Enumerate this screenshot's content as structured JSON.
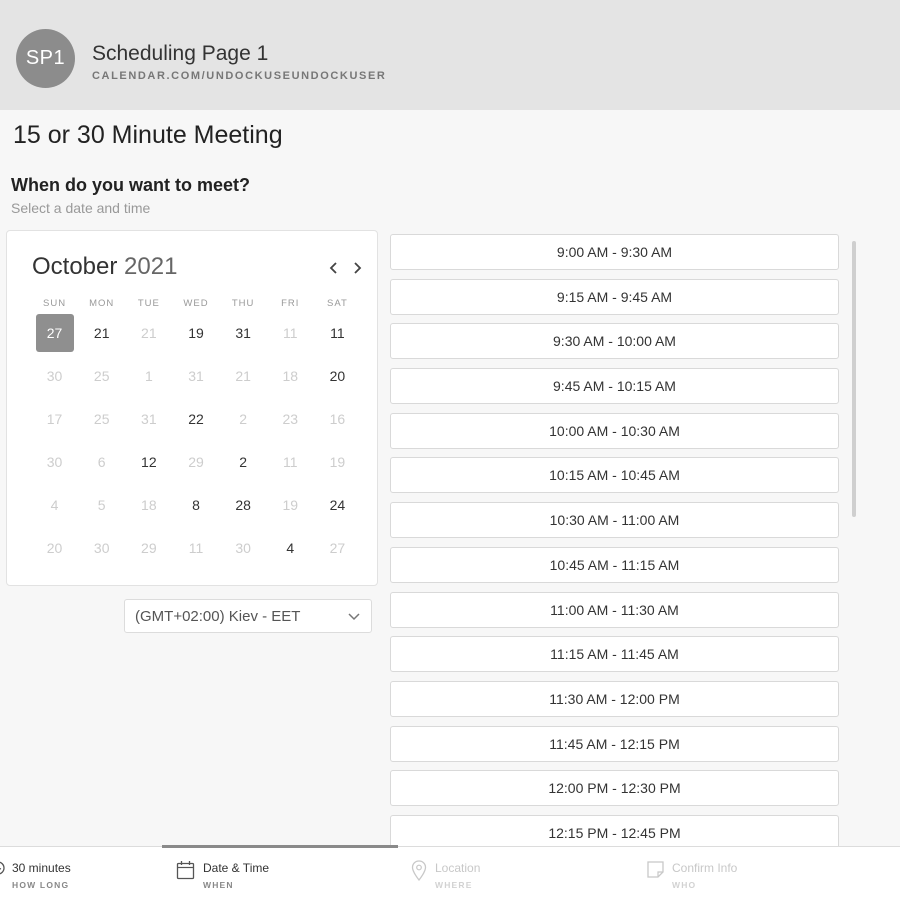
{
  "header": {
    "avatar_initials": "SP1",
    "page_name": "Scheduling Page 1",
    "page_url": "CALENDAR.COM/UNDOCKUSEUNDOCKUSER"
  },
  "meeting": {
    "title": "15 or 30 Minute Meeting",
    "question": "When do you want to meet?",
    "instruction": "Select a date and time"
  },
  "calendar": {
    "month": "October",
    "year": "2021",
    "prev_icon": "chevron-left-icon",
    "next_icon": "chevron-right-icon",
    "weekdays": [
      "SUN",
      "MON",
      "TUE",
      "WED",
      "THU",
      "FRI",
      "SAT"
    ],
    "days": [
      {
        "label": "27",
        "active": true,
        "selected": true
      },
      {
        "label": "21",
        "active": true
      },
      {
        "label": "21",
        "active": false
      },
      {
        "label": "19",
        "active": true
      },
      {
        "label": "31",
        "active": true
      },
      {
        "label": "11",
        "active": false
      },
      {
        "label": "11",
        "active": true
      },
      {
        "label": "30",
        "active": false
      },
      {
        "label": "25",
        "active": false
      },
      {
        "label": "1",
        "active": false
      },
      {
        "label": "31",
        "active": false
      },
      {
        "label": "21",
        "active": false
      },
      {
        "label": "18",
        "active": false
      },
      {
        "label": "20",
        "active": true
      },
      {
        "label": "17",
        "active": false
      },
      {
        "label": "25",
        "active": false
      },
      {
        "label": "31",
        "active": false
      },
      {
        "label": "22",
        "active": true
      },
      {
        "label": "2",
        "active": false
      },
      {
        "label": "23",
        "active": false
      },
      {
        "label": "16",
        "active": false
      },
      {
        "label": "30",
        "active": false
      },
      {
        "label": "6",
        "active": false
      },
      {
        "label": "12",
        "active": true
      },
      {
        "label": "29",
        "active": false
      },
      {
        "label": "2",
        "active": true
      },
      {
        "label": "11",
        "active": false
      },
      {
        "label": "19",
        "active": false
      },
      {
        "label": "4",
        "active": false
      },
      {
        "label": "5",
        "active": false
      },
      {
        "label": "18",
        "active": false
      },
      {
        "label": "8",
        "active": true
      },
      {
        "label": "28",
        "active": true
      },
      {
        "label": "19",
        "active": false
      },
      {
        "label": "24",
        "active": true
      },
      {
        "label": "20",
        "active": false
      },
      {
        "label": "30",
        "active": false
      },
      {
        "label": "29",
        "active": false
      },
      {
        "label": "11",
        "active": false
      },
      {
        "label": "30",
        "active": false
      },
      {
        "label": "4",
        "active": true
      },
      {
        "label": "27",
        "active": false
      }
    ]
  },
  "timezone": {
    "value": "(GMT+02:00) Kiev - EET",
    "icon": "chevron-down-icon"
  },
  "slots": [
    "9:00 AM - 9:30 AM",
    "9:15 AM - 9:45 AM",
    "9:30 AM - 10:00 AM",
    "9:45 AM - 10:15 AM",
    "10:00 AM - 10:30 AM",
    "10:15 AM - 10:45 AM",
    "10:30 AM - 11:00 AM",
    "10:45 AM - 11:15 AM",
    "11:00 AM - 11:30 AM",
    "11:15 AM - 11:45 AM",
    "11:30 AM - 12:00 PM",
    "11:45 AM - 12:15 PM",
    "12:00 PM - 12:30 PM",
    "12:15 PM - 12:45 PM"
  ],
  "steps": [
    {
      "title": "30 minutes",
      "sub": "HOW LONG",
      "icon": "clock-icon",
      "state": "done"
    },
    {
      "title": "Date & Time",
      "sub": "WHEN",
      "icon": "calendar-icon",
      "state": "current"
    },
    {
      "title": "Location",
      "sub": "WHERE",
      "icon": "location-pin-icon",
      "state": "future"
    },
    {
      "title": "Confirm Info",
      "sub": "WHO",
      "icon": "note-icon",
      "state": "future"
    }
  ],
  "colors": {
    "header_bg": "#e4e4e4",
    "avatar_bg": "#8c8c8c",
    "selected_day_bg": "#8f8f8f",
    "progress": "#8a8a8a"
  }
}
